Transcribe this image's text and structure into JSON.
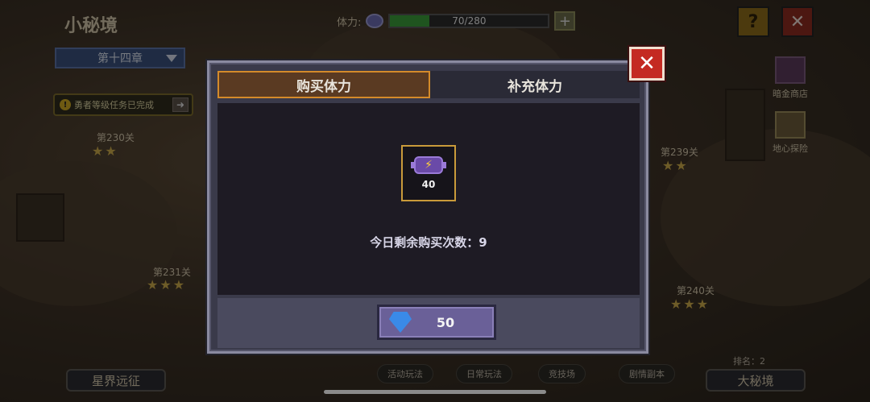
{
  "header": {
    "area_title": "小秘境",
    "chapter": "第十四章",
    "stamina_label": "体力:",
    "stamina_value": "70/280",
    "stamina_fraction": 0.25,
    "help_symbol": "?",
    "close_symbol": "✕"
  },
  "quest_notice": {
    "text": "勇者等级任务已完成"
  },
  "stages": [
    {
      "label": "第230关",
      "stars": "★★"
    },
    {
      "label": "第231关",
      "stars": "★★★"
    },
    {
      "label": "第239关",
      "stars": "★★"
    },
    {
      "label": "第240关",
      "stars": "★★★"
    }
  ],
  "side_menu": [
    {
      "label": "暗金商店",
      "icon": "chest-icon"
    },
    {
      "label": "地心探险",
      "icon": "crystal-icon"
    }
  ],
  "bottom_nav": {
    "left_label": "星界远征",
    "right_label": "大秘境",
    "rank_text": "排名：2",
    "mini_buttons": [
      "活动玩法",
      "日常玩法",
      "竞技场",
      "剧情副本"
    ]
  },
  "dialog": {
    "tabs": [
      {
        "label": "购买体力",
        "active": true
      },
      {
        "label": "补充体力",
        "active": false
      }
    ],
    "item": {
      "icon": "energy-battery-icon",
      "count": "40"
    },
    "remaining_text": "今日剩余购买次数：9",
    "buy_price": "50",
    "price_icon": "diamond-icon",
    "close_symbol": "✕"
  },
  "colors": {
    "active_tab_border": "#d48a2a",
    "close_red": "#c42a22",
    "buy_button": "#6a6098"
  }
}
